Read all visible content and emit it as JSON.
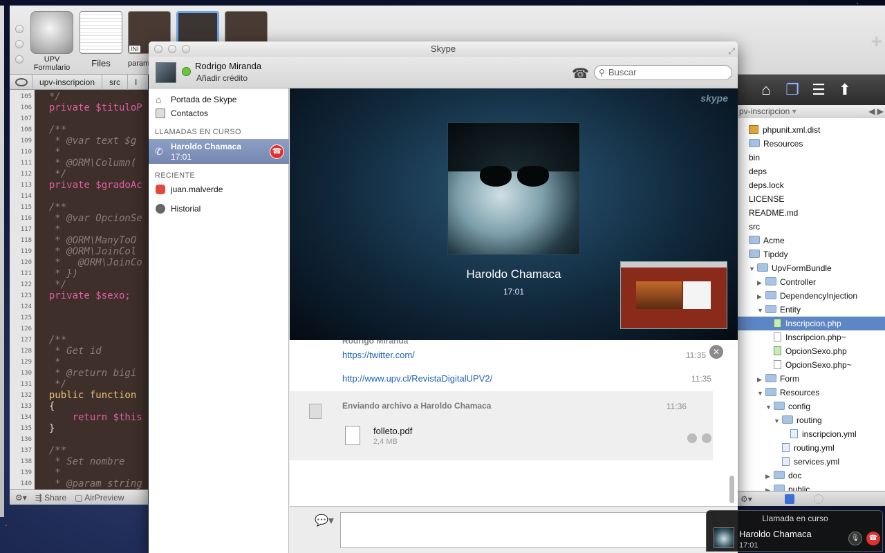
{
  "editor": {
    "tabs": [
      {
        "label": "UPV\nFormulario"
      },
      {
        "label": "Files"
      },
      {
        "label": "param"
      }
    ],
    "thumb_ini_label": "INI",
    "breadcrumb": [
      "upv-inscripcion",
      "src",
      "I"
    ],
    "status": {
      "settings_icon": "gear-icon",
      "share_label": "Share",
      "airpreview_label": "AirPreview"
    },
    "code_lines": [
      {
        "n": "105",
        "t": "  */",
        "c": "comment"
      },
      {
        "n": "106",
        "t": "  private $tituloP",
        "c": "kw"
      },
      {
        "n": "107",
        "t": "",
        "c": ""
      },
      {
        "n": "108",
        "t": "  /**",
        "c": "comment"
      },
      {
        "n": "109",
        "t": "   * @var text $g",
        "c": "comment"
      },
      {
        "n": "110",
        "t": "   *",
        "c": "comment"
      },
      {
        "n": "111",
        "t": "   * @ORM\\Column(",
        "c": "comment"
      },
      {
        "n": "112",
        "t": "   */",
        "c": "comment"
      },
      {
        "n": "113",
        "t": "  private $gradoAc",
        "c": "kw"
      },
      {
        "n": "114",
        "t": "",
        "c": ""
      },
      {
        "n": "115",
        "t": "  /**",
        "c": "comment"
      },
      {
        "n": "116",
        "t": "   * @var OpcionSe",
        "c": "comment"
      },
      {
        "n": "117",
        "t": "   *",
        "c": "comment"
      },
      {
        "n": "118",
        "t": "   * @ORM\\ManyToO",
        "c": "comment"
      },
      {
        "n": "119",
        "t": "   * @ORM\\JoinCol",
        "c": "comment"
      },
      {
        "n": "120",
        "t": "   *   @ORM\\JoinCo",
        "c": "comment"
      },
      {
        "n": "121",
        "t": "   * })",
        "c": "comment"
      },
      {
        "n": "122",
        "t": "   */",
        "c": "comment"
      },
      {
        "n": "123",
        "t": "  private $sexo;",
        "c": "kw"
      },
      {
        "n": "124",
        "t": "",
        "c": ""
      },
      {
        "n": "125",
        "t": "",
        "c": ""
      },
      {
        "n": "126",
        "t": "",
        "c": ""
      },
      {
        "n": "127",
        "t": "  /**",
        "c": "comment"
      },
      {
        "n": "128",
        "t": "   * Get id",
        "c": "comment"
      },
      {
        "n": "129",
        "t": "   *",
        "c": "comment"
      },
      {
        "n": "130",
        "t": "   * @return bigi",
        "c": "comment"
      },
      {
        "n": "131",
        "t": "   */",
        "c": "comment"
      },
      {
        "n": "132",
        "t": "  public function",
        "c": "fn"
      },
      {
        "n": "133",
        "t": "  {",
        "c": ""
      },
      {
        "n": "134",
        "t": "      return $this",
        "c": "kw"
      },
      {
        "n": "135",
        "t": "  }",
        "c": ""
      },
      {
        "n": "136",
        "t": "",
        "c": ""
      },
      {
        "n": "137",
        "t": "  /**",
        "c": "comment"
      },
      {
        "n": "138",
        "t": "   * Set nombre",
        "c": "comment"
      },
      {
        "n": "139",
        "t": "   *",
        "c": "comment"
      },
      {
        "n": "140",
        "t": "   * @param string",
        "c": "comment"
      }
    ]
  },
  "file_browser": {
    "path_label": "pv-inscripcion",
    "items": [
      {
        "label": "phpunit.xml.dist",
        "kind": "pkg",
        "indent": 0,
        "tri": ""
      },
      {
        "label": "Resources",
        "kind": "folder",
        "indent": 0,
        "tri": ""
      },
      {
        "label": "bin",
        "kind": "plain",
        "indent": 0,
        "tri": ""
      },
      {
        "label": "deps",
        "kind": "plain",
        "indent": 0,
        "tri": ""
      },
      {
        "label": "deps.lock",
        "kind": "plain",
        "indent": 0,
        "tri": ""
      },
      {
        "label": "LICENSE",
        "kind": "plain",
        "indent": 0,
        "tri": ""
      },
      {
        "label": "README.md",
        "kind": "plain",
        "indent": 0,
        "tri": ""
      },
      {
        "label": "src",
        "kind": "plain",
        "indent": 0,
        "tri": ""
      },
      {
        "label": "Acme",
        "kind": "folder",
        "indent": 0,
        "tri": ""
      },
      {
        "label": "Tipddy",
        "kind": "folder",
        "indent": 0,
        "tri": ""
      },
      {
        "label": "UpvFormBundle",
        "kind": "folder",
        "indent": 1,
        "tri": "▼"
      },
      {
        "label": "Controller",
        "kind": "folder",
        "indent": 2,
        "tri": "▶"
      },
      {
        "label": "DependencyInjection",
        "kind": "folder",
        "indent": 2,
        "tri": "▶"
      },
      {
        "label": "Entity",
        "kind": "folder",
        "indent": 2,
        "tri": "▼"
      },
      {
        "label": "Inscripcion.php",
        "kind": "green",
        "indent": 3,
        "tri": "",
        "selected": true
      },
      {
        "label": "Inscripcion.php~",
        "kind": "file",
        "indent": 3,
        "tri": ""
      },
      {
        "label": "OpcionSexo.php",
        "kind": "green",
        "indent": 3,
        "tri": ""
      },
      {
        "label": "OpcionSexo.php~",
        "kind": "file",
        "indent": 3,
        "tri": ""
      },
      {
        "label": "Form",
        "kind": "folder",
        "indent": 2,
        "tri": "▶"
      },
      {
        "label": "Resources",
        "kind": "folder",
        "indent": 2,
        "tri": "▼"
      },
      {
        "label": "config",
        "kind": "folder",
        "indent": 3,
        "tri": "▼"
      },
      {
        "label": "routing",
        "kind": "folder",
        "indent": 4,
        "tri": "▼"
      },
      {
        "label": "inscripcion.yml",
        "kind": "yml",
        "indent": 5,
        "tri": ""
      },
      {
        "label": "routing.yml",
        "kind": "yml",
        "indent": 4,
        "tri": ""
      },
      {
        "label": "services.yml",
        "kind": "yml",
        "indent": 4,
        "tri": ""
      },
      {
        "label": "doc",
        "kind": "folder",
        "indent": 3,
        "tri": "▶"
      },
      {
        "label": "public",
        "kind": "folder",
        "indent": 3,
        "tri": "▶"
      }
    ]
  },
  "skype": {
    "window_title": "Skype",
    "user": {
      "name": "Rodrigo Miranda",
      "credit_link": "Añadir crédito"
    },
    "search": {
      "placeholder": "Buscar"
    },
    "sidebar": {
      "home": "Portada de Skype",
      "contacts": "Contactos",
      "section_calls": "LLAMADAS EN CURSO",
      "active_call": {
        "name": "Haroldo Chamaca",
        "time": "17:01"
      },
      "section_recent": "RECIENTE",
      "recent": [
        {
          "label": "juan.malverde"
        }
      ],
      "history": "Historial"
    },
    "video": {
      "brand": "skype",
      "callee_name": "Haroldo Chamaca",
      "call_time": "17:01"
    },
    "chat": {
      "sender": "Rodrigo Miranda",
      "messages": [
        {
          "text": "https://twitter.com/",
          "time": "11:35"
        },
        {
          "text": "http://www.upv.cl/RevistaDigitalUPV2/",
          "time": "11:35"
        }
      ],
      "file_transfer": {
        "title": "Enviando archivo a Haroldo Chamaca",
        "time": "11:36",
        "filename": "folleto.pdf",
        "size": "2,4 MB"
      }
    }
  },
  "notification": {
    "header": "Llamada en curso",
    "name": "Haroldo Chamaca",
    "time": "17:01"
  }
}
